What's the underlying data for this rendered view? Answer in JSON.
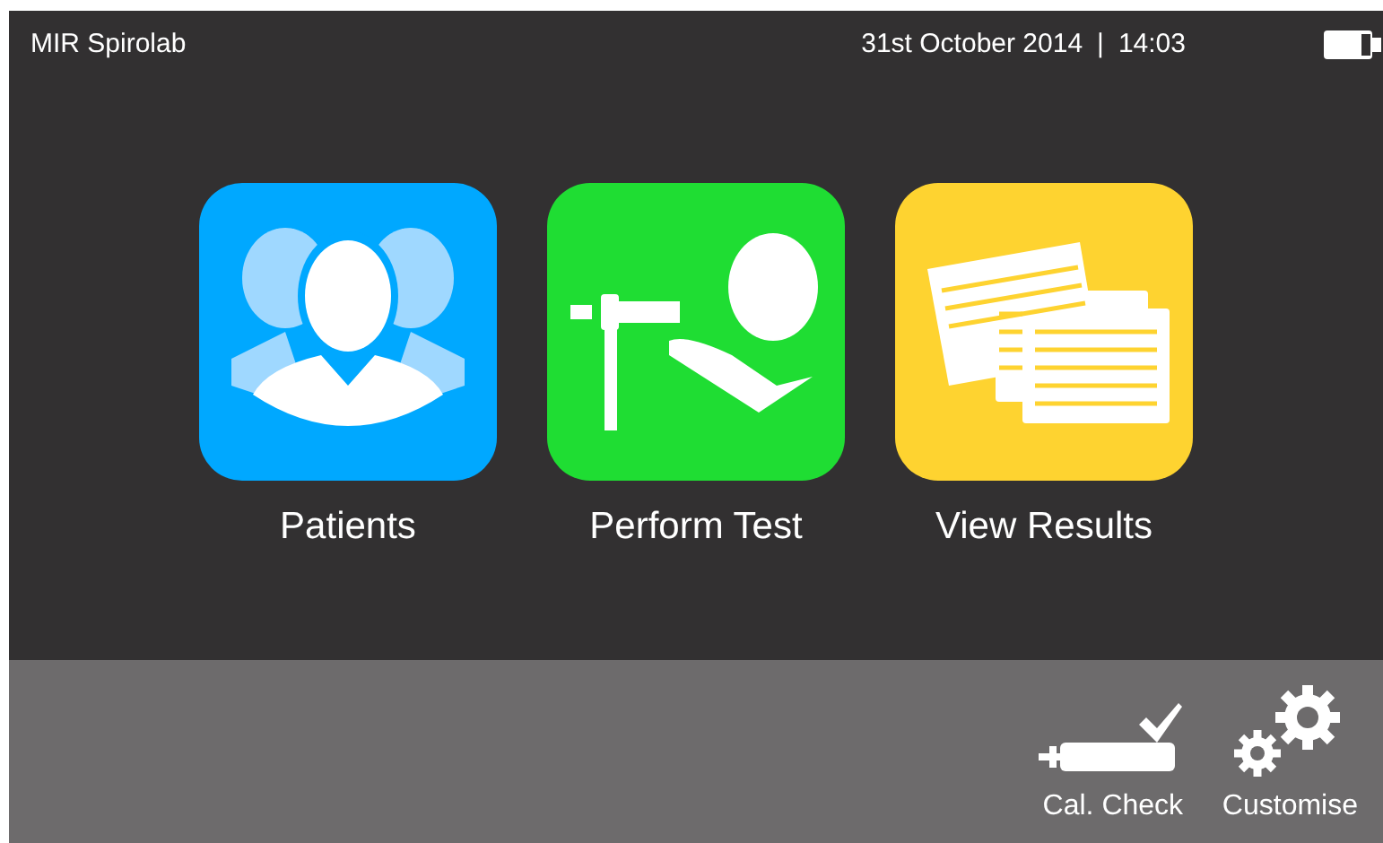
{
  "header": {
    "title": "MIR Spirolab",
    "date": "31st October 2014",
    "separator": "|",
    "time": "14:03"
  },
  "tiles": [
    {
      "kind": "patients",
      "label": "Patients",
      "color": "#00a8ff"
    },
    {
      "kind": "test",
      "label": "Perform Test",
      "color": "#1fdd33"
    },
    {
      "kind": "results",
      "label": "View Results",
      "color": "#fed330"
    }
  ],
  "toolbar": [
    {
      "kind": "calibration",
      "label": "Cal. Check"
    },
    {
      "kind": "settings",
      "label": "Customise"
    }
  ]
}
